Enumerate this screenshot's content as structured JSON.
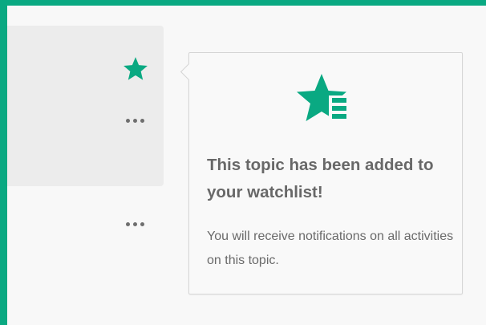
{
  "colors": {
    "accent": "#0aa982",
    "icon_gray": "#6e6e6e",
    "text_gray": "#686868"
  },
  "icons": {
    "star": "star-icon",
    "more": "more-icon",
    "watchlist": "watchlist-icon"
  },
  "popover": {
    "title": "This topic has been added to your watchlist!",
    "body": "You will receive notifications on all activities on this topic."
  }
}
